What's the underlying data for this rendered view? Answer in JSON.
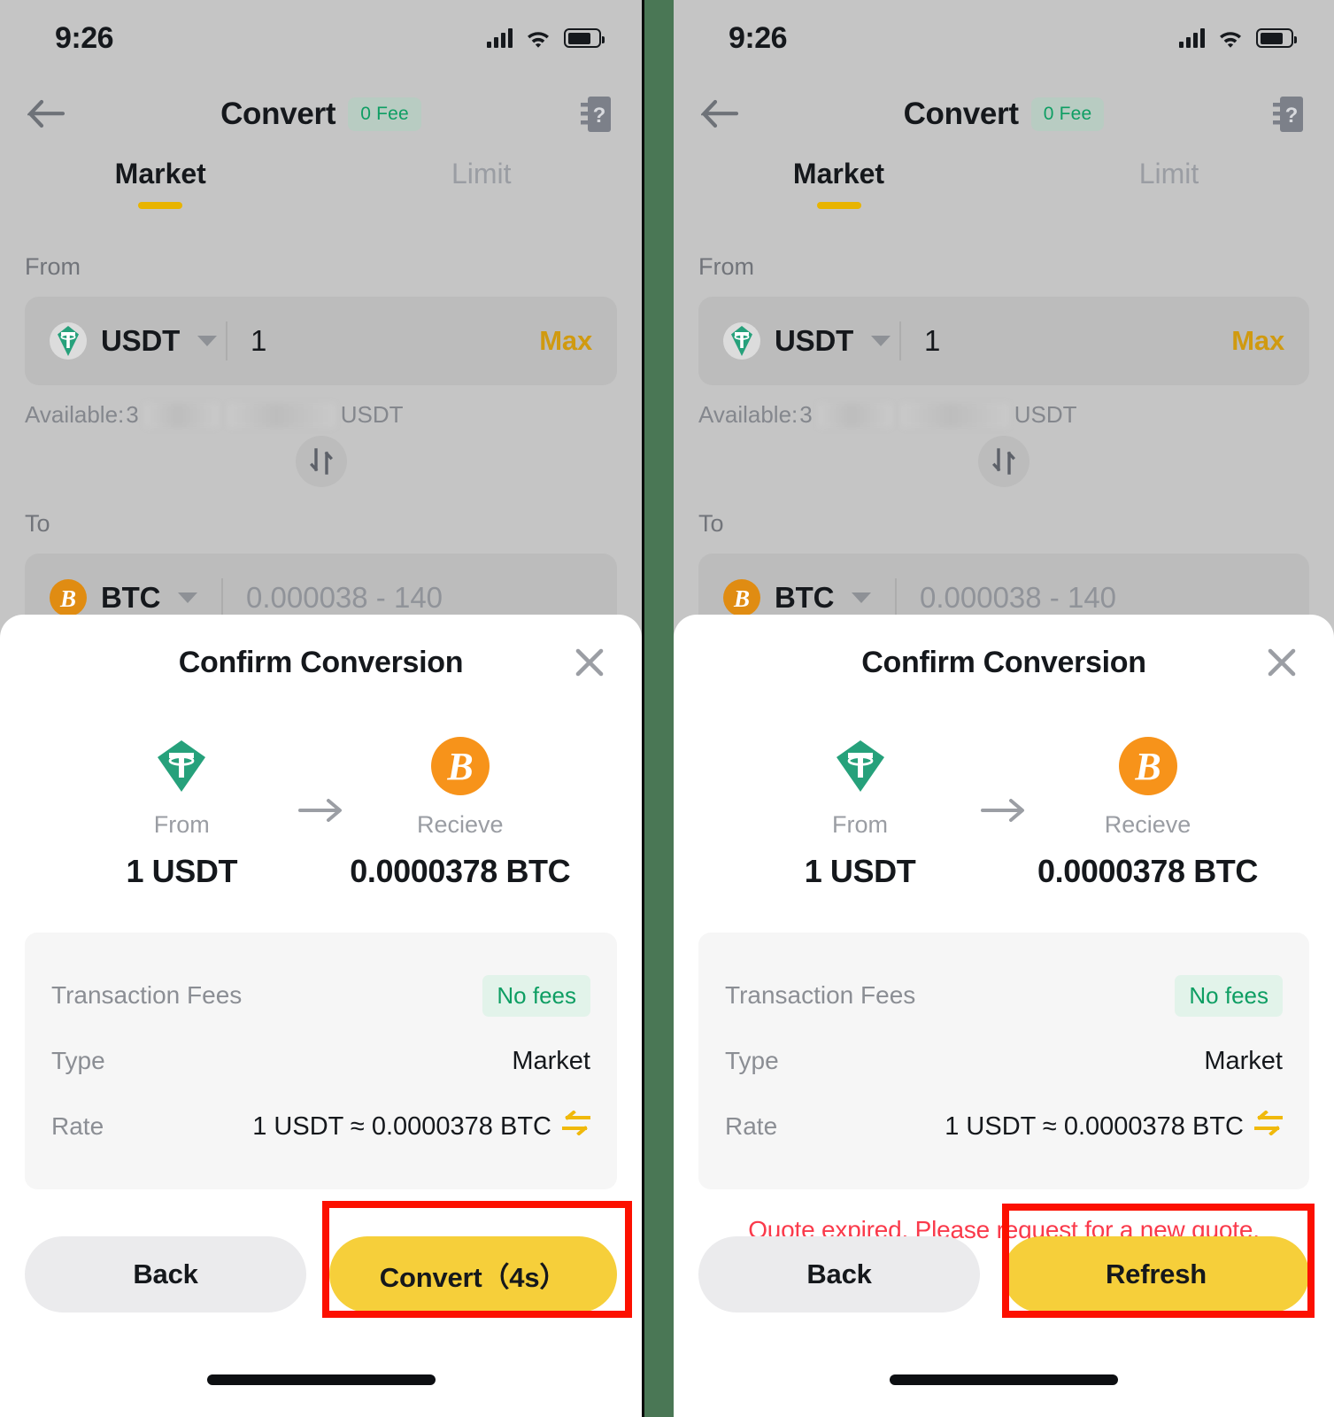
{
  "status_bar": {
    "time": "9:26",
    "cellular_icon": "cellular-signal-icon",
    "wifi_icon": "wifi-icon",
    "battery_icon": "battery-icon"
  },
  "header": {
    "back_icon": "back-arrow-icon",
    "title": "Convert",
    "fee_badge": "0 Fee",
    "help_icon": "help-book-icon"
  },
  "tabs": [
    {
      "label": "Market",
      "active": true
    },
    {
      "label": "Limit",
      "active": false
    }
  ],
  "form": {
    "from_label": "From",
    "from_coin": "USDT",
    "from_coin_icon": "tether-logo-icon",
    "from_amount": "1",
    "max_label": "Max",
    "available_prefix": "Available:",
    "available_value_masked": "3",
    "available_currency": "USDT",
    "swap_icon": "swap-vertical-icon",
    "to_label": "To",
    "to_coin": "BTC",
    "to_coin_icon": "bitcoin-logo-icon",
    "to_amount_placeholder": "0.000038 - 140"
  },
  "modal": {
    "title": "Confirm Conversion",
    "close_icon": "close-x-icon",
    "from_caption": "From",
    "from_value": "1 USDT",
    "from_icon": "tether-logo-icon",
    "arrow_icon": "arrow-right-icon",
    "receive_caption": "Recieve",
    "receive_value": "0.0000378 BTC",
    "receive_icon": "bitcoin-logo-icon",
    "details": [
      {
        "key": "Transaction Fees",
        "value": "No fees",
        "badge": true
      },
      {
        "key": "Type",
        "value": "Market",
        "badge": false
      },
      {
        "key": "Rate",
        "value": "1 USDT ≈ 0.0000378 BTC",
        "badge": false,
        "swap_icon": "rate-swap-icon"
      }
    ],
    "back_label": "Back"
  },
  "left_panel": {
    "primary_label": "Convert（4s）",
    "highlighted": "convert-button"
  },
  "right_panel": {
    "error_message": "Quote expired. Please request for a new quote.",
    "primary_label": "Refresh",
    "highlighted": "refresh-button"
  },
  "colors": {
    "accent_yellow": "#f6cf3a",
    "tab_underline": "#e8b400",
    "max_orange": "#d09a10",
    "green_text": "#0e9e63",
    "error_red": "#fa3a4b",
    "highlight_red": "#fc1000",
    "divider_green": "#4a7755",
    "screen_bg": "#c5c5c5",
    "tether_green": "#26a17b",
    "bitcoin_orange": "#f7931a"
  }
}
